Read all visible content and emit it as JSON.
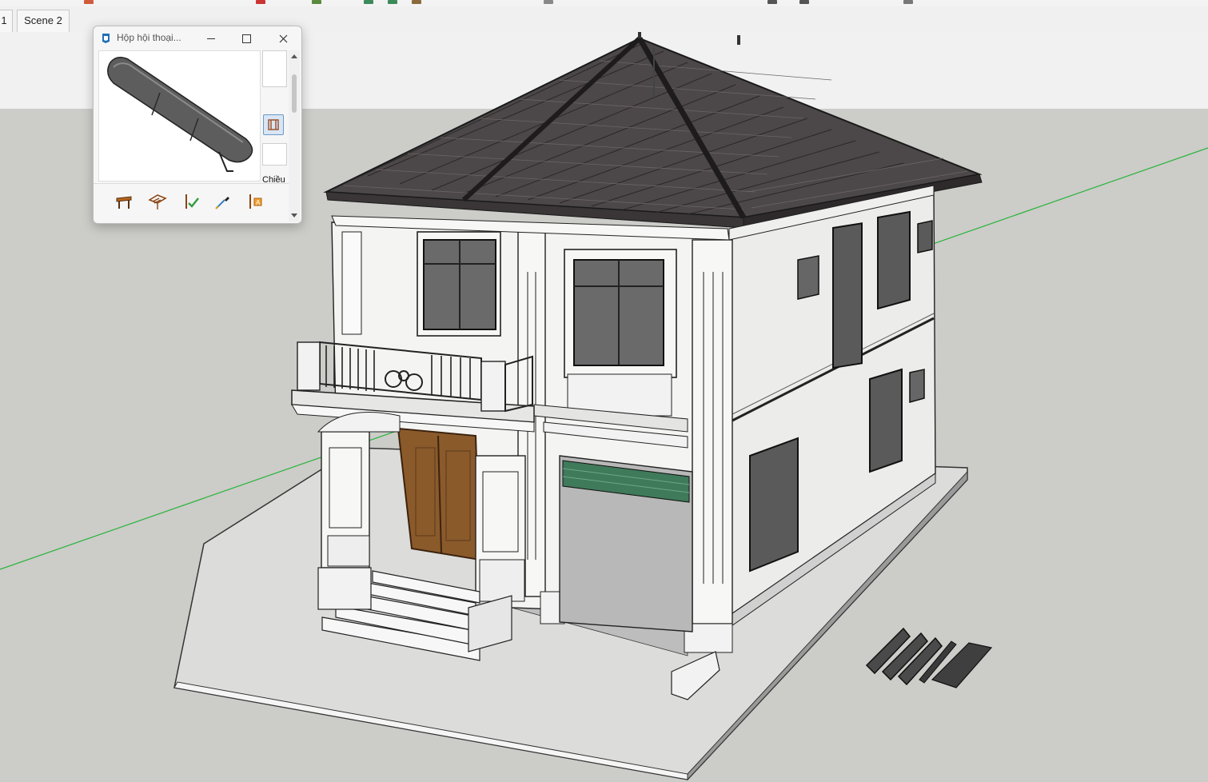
{
  "tabs": [
    {
      "label": "1"
    },
    {
      "label": "Scene 2"
    }
  ],
  "dialog": {
    "title": "Hộp hội thoại...",
    "app_icon": "sketchup-icon",
    "window_buttons": [
      "minimize-icon",
      "maximize-icon",
      "close-icon"
    ],
    "side_label": "Chiều",
    "preview_icon": "ridge-tile-component",
    "tools": [
      "ridge-tool-icon",
      "roof-frame-icon",
      "check-tool-icon",
      "eyedropper-icon",
      "attribute-tool-icon"
    ]
  },
  "colors": {
    "sky": "#f1f1f1",
    "ground": "#ccccc8",
    "roof": "#4c4748",
    "wall": "#f4f4f2",
    "door": "#8b5a2b",
    "green_axis": "#27b43a",
    "accent": "#3a7fc4"
  }
}
